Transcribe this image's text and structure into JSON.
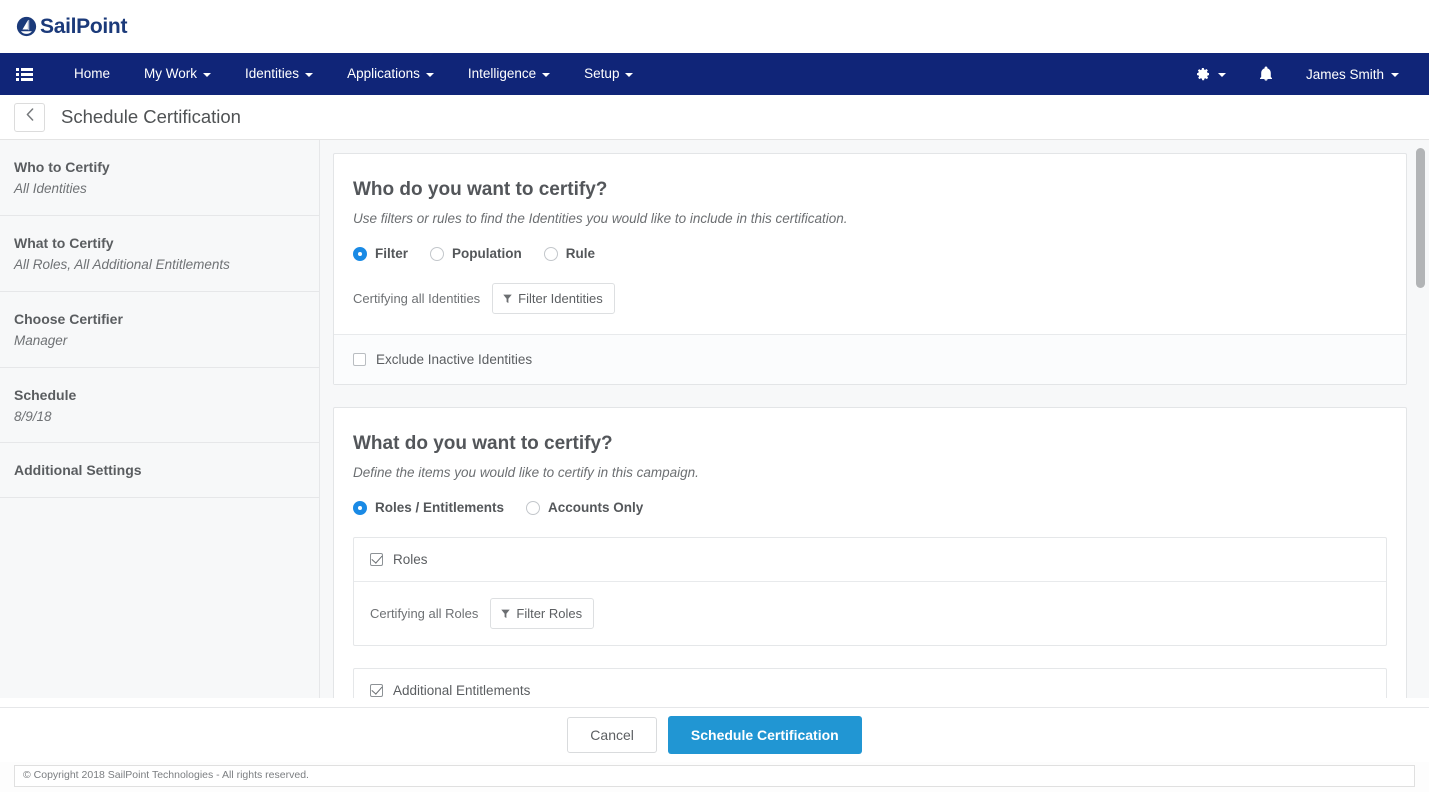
{
  "brand": {
    "name": "SailPoint",
    "logo_icon": "sailpoint-logo-icon",
    "color": "#1b3a7a"
  },
  "navbar": {
    "bg_color": "#102578",
    "menu_icon": "list-menu-icon",
    "items": [
      {
        "label": "Home",
        "has_caret": false
      },
      {
        "label": "My Work",
        "has_caret": true
      },
      {
        "label": "Identities",
        "has_caret": true
      },
      {
        "label": "Applications",
        "has_caret": true
      },
      {
        "label": "Intelligence",
        "has_caret": true
      },
      {
        "label": "Setup",
        "has_caret": true
      }
    ],
    "right": {
      "gear_icon": "gear-icon",
      "bell_icon": "bell-notification-icon",
      "user_name": "James Smith"
    }
  },
  "titlebar": {
    "back_icon": "chevron-left-icon",
    "title": "Schedule Certification"
  },
  "sidebar": {
    "items": [
      {
        "title": "Who to Certify",
        "sub": "All Identities"
      },
      {
        "title": "What to Certify",
        "sub": "All Roles, All Additional Entitlements"
      },
      {
        "title": "Choose Certifier",
        "sub": "Manager"
      },
      {
        "title": "Schedule",
        "sub": "8/9/18"
      },
      {
        "title": "Additional Settings",
        "sub": ""
      }
    ]
  },
  "main": {
    "who_card": {
      "heading": "Who do you want to certify?",
      "description": "Use filters or rules to find the Identities you would like to include in this certification.",
      "radio_options": [
        {
          "label": "Filter",
          "selected": true
        },
        {
          "label": "Population",
          "selected": false
        },
        {
          "label": "Rule",
          "selected": false
        }
      ],
      "filter_note": "Certifying all Identities",
      "filter_button": "Filter Identities",
      "filter_icon": "funnel-filter-icon",
      "exclude_checkbox": {
        "label": "Exclude Inactive Identities",
        "checked": false
      }
    },
    "what_card": {
      "heading": "What do you want to certify?",
      "description": "Define the items you would like to certify in this campaign.",
      "radio_options": [
        {
          "label": "Roles / Entitlements",
          "selected": true
        },
        {
          "label": "Accounts Only",
          "selected": false
        }
      ],
      "roles_panel": {
        "checkbox_label": "Roles",
        "checked": true,
        "filter_note": "Certifying all Roles",
        "filter_button": "Filter Roles",
        "filter_icon": "funnel-filter-icon"
      },
      "entitlements_panel": {
        "checkbox_label": "Additional Entitlements",
        "checked": true
      }
    }
  },
  "footer": {
    "cancel_label": "Cancel",
    "primary_label": "Schedule Certification",
    "primary_color": "#2196d3"
  },
  "copyright": "© Copyright 2018 SailPoint Technologies - All rights reserved.",
  "scrollbar": {
    "thumb_color": "#b2b4b6"
  },
  "accent": {
    "radio_selected": "#1a8ae5"
  }
}
